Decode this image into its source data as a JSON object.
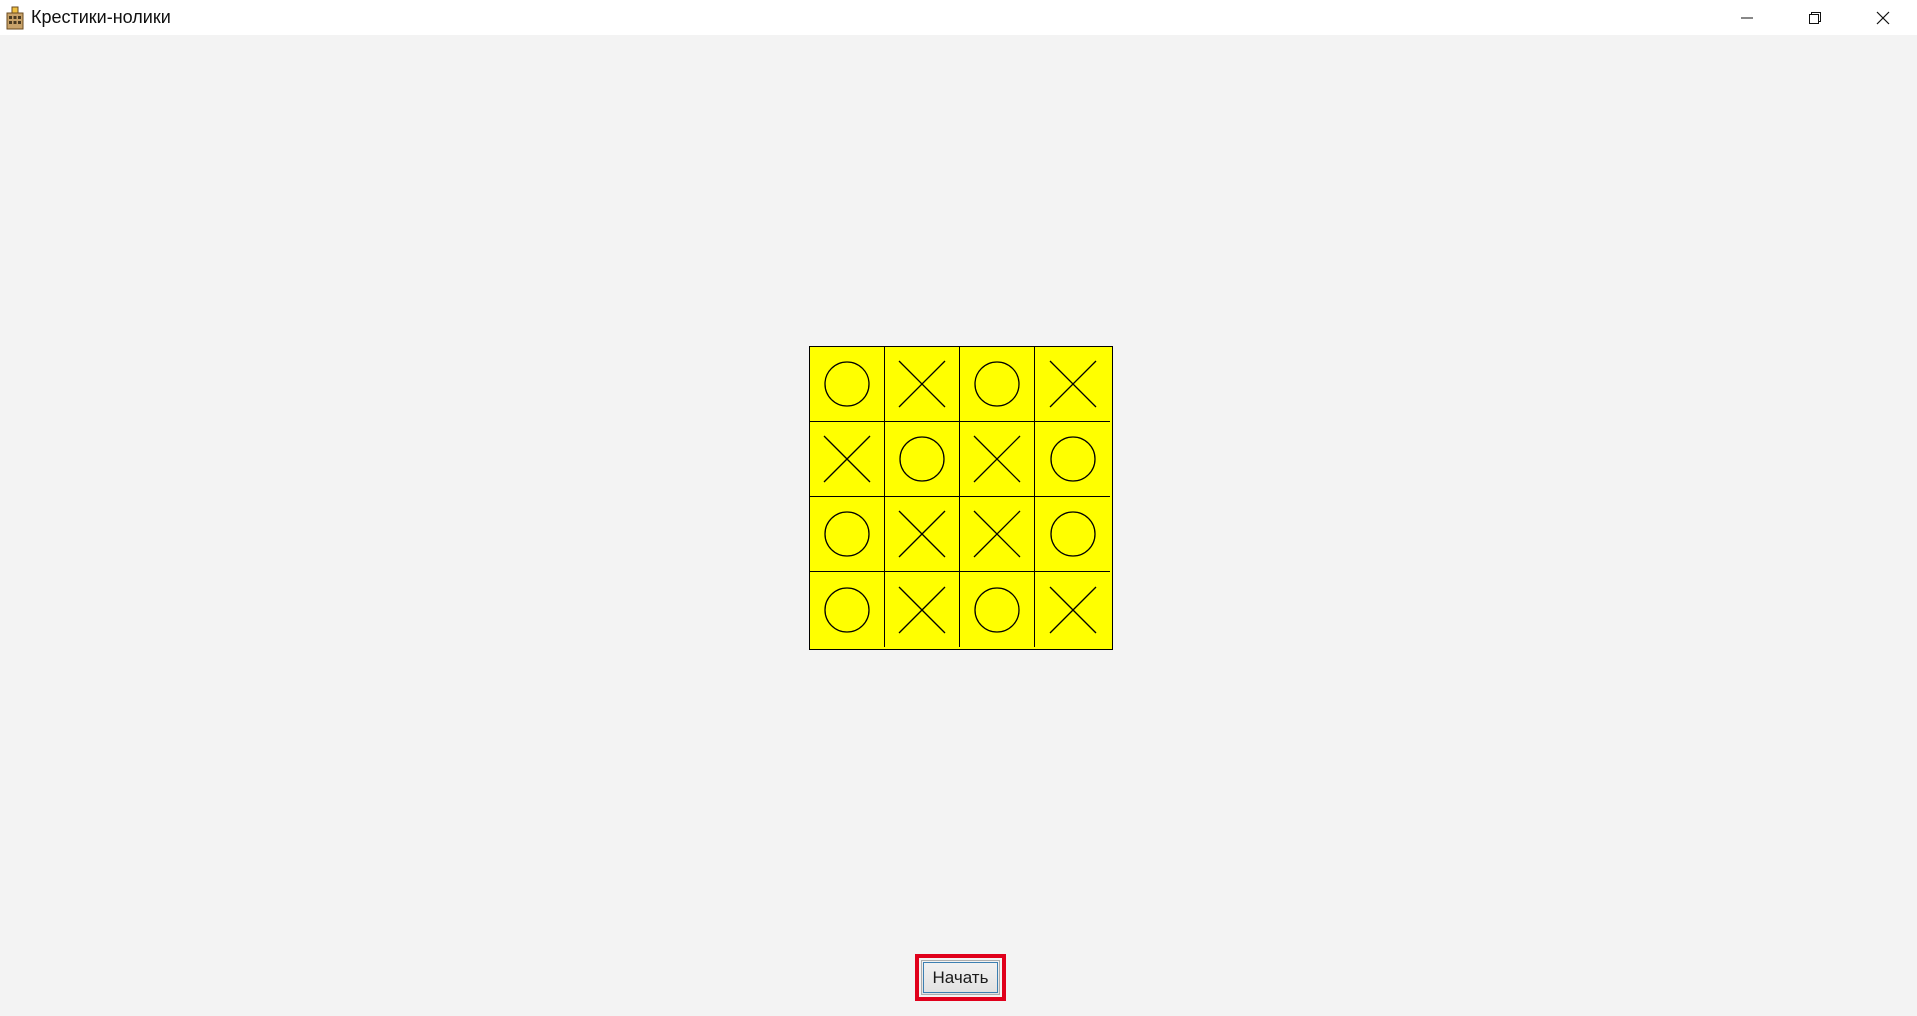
{
  "window": {
    "title": "Крестики-нолики",
    "icon": "app-building-icon",
    "controls": [
      "minimize-icon",
      "restore-icon",
      "close-icon"
    ]
  },
  "board": {
    "size": 4,
    "cell_color": "#ffff00",
    "line_color": "#000000",
    "cells": [
      [
        "O",
        "X",
        "O",
        "X"
      ],
      [
        "X",
        "O",
        "X",
        "O"
      ],
      [
        "O",
        "X",
        "X",
        "O"
      ],
      [
        "O",
        "X",
        "O",
        "X"
      ]
    ]
  },
  "start_button": {
    "label": "Начать",
    "highlight_color": "#e0001b"
  }
}
